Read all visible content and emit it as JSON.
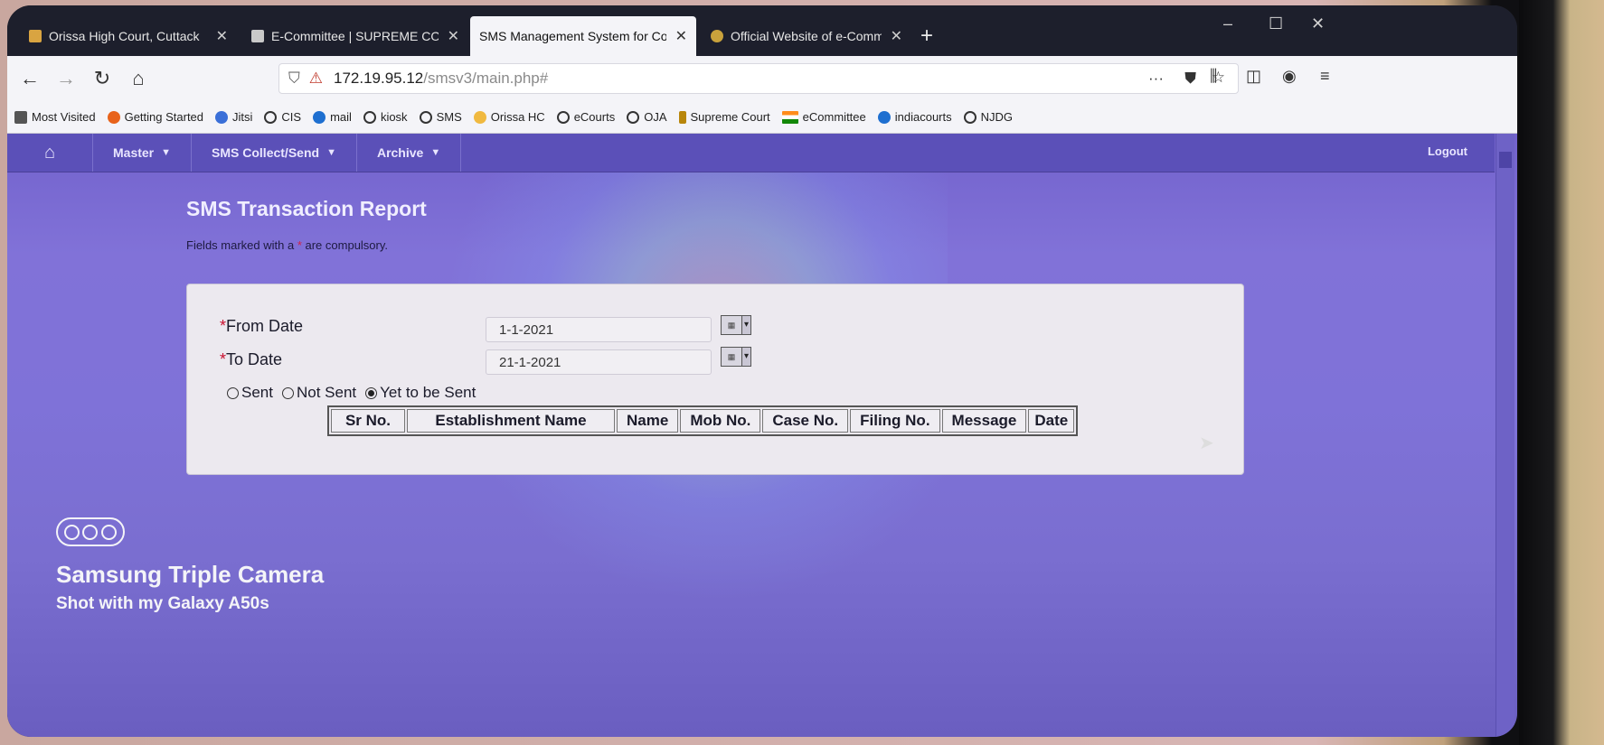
{
  "browser": {
    "tabs": [
      {
        "label": "Orissa High Court, Cuttack",
        "active": false
      },
      {
        "label": "E-Committee | SUPREME COU",
        "active": false
      },
      {
        "label": "SMS Management System for Cou",
        "active": true
      },
      {
        "label": "Official Website of e-Committ",
        "active": false
      }
    ],
    "url_host": "172.19.95.12",
    "url_path": "/smsv3/main.php#",
    "bookmarks": [
      {
        "label": "Most Visited",
        "color": "#555555"
      },
      {
        "label": "Getting Started",
        "color": "#e8631b"
      },
      {
        "label": "Jitsi",
        "color": "#3a6fd8"
      },
      {
        "label": "CIS",
        "color": "#333333"
      },
      {
        "label": "mail",
        "color": "#1e6fd0"
      },
      {
        "label": "kiosk",
        "color": "#333333"
      },
      {
        "label": "SMS",
        "color": "#333333"
      },
      {
        "label": "Orissa HC",
        "color": "#f0b940"
      },
      {
        "label": "eCourts",
        "color": "#333333"
      },
      {
        "label": "OJA",
        "color": "#333333"
      },
      {
        "label": "Supreme Court",
        "color": "#b8860b"
      },
      {
        "label": "eCommittee",
        "color": "#ff8c1a"
      },
      {
        "label": "indiacourts",
        "color": "#1e6fd0"
      },
      {
        "label": "NJDG",
        "color": "#333333"
      }
    ]
  },
  "menu": {
    "master": "Master",
    "sms_collect": "SMS Collect/Send",
    "archive": "Archive",
    "logout": "Logout"
  },
  "report": {
    "title": "SMS Transaction Report",
    "note_prefix": "Fields marked with a ",
    "note_star": "*",
    "note_suffix": " are compulsory.",
    "from_label": "From Date",
    "from_value": "1-1-2021",
    "to_label": "To Date",
    "to_value": "21-1-2021",
    "required_mark": "*",
    "radio_options": [
      {
        "label": "Sent",
        "checked": false
      },
      {
        "label": "Not Sent",
        "checked": false
      },
      {
        "label": "Yet to be Sent",
        "checked": true
      }
    ],
    "columns": [
      "Sr No.",
      "Establishment Name",
      "Name",
      "Mob No.",
      "Case No.",
      "Filing No.",
      "Message",
      "Date"
    ]
  },
  "watermark": {
    "title": "Samsung Triple Camera",
    "subtitle": "Shot with my Galaxy A50s"
  },
  "colors": {
    "page_bg": "#7f72d8",
    "menu_bg": "#5b50b8",
    "panel_bg": "#ece9ef",
    "required": "#c8102e"
  }
}
